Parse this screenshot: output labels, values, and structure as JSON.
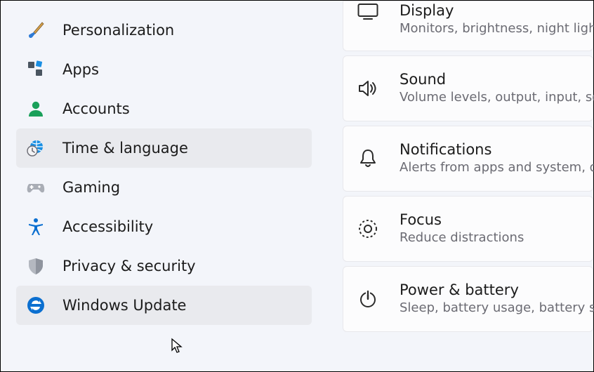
{
  "sidebar": {
    "items": [
      {
        "id": "personalization",
        "label": "Personalization"
      },
      {
        "id": "apps",
        "label": "Apps"
      },
      {
        "id": "accounts",
        "label": "Accounts"
      },
      {
        "id": "time-language",
        "label": "Time & language"
      },
      {
        "id": "gaming",
        "label": "Gaming"
      },
      {
        "id": "accessibility",
        "label": "Accessibility"
      },
      {
        "id": "privacy",
        "label": "Privacy & security"
      },
      {
        "id": "update",
        "label": "Windows Update"
      }
    ]
  },
  "cards": [
    {
      "id": "display",
      "title": "Display",
      "sub": "Monitors, brightness, night light,"
    },
    {
      "id": "sound",
      "title": "Sound",
      "sub": "Volume levels, output, input, sour"
    },
    {
      "id": "notifications",
      "title": "Notifications",
      "sub": "Alerts from apps and system, do n"
    },
    {
      "id": "focus",
      "title": "Focus",
      "sub": "Reduce distractions"
    },
    {
      "id": "power",
      "title": "Power & battery",
      "sub": "Sleep, battery usage, battery save"
    }
  ]
}
